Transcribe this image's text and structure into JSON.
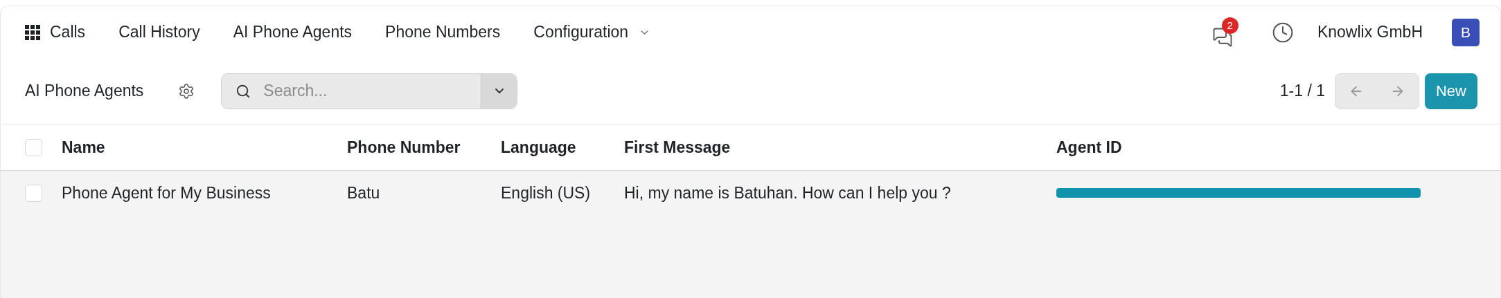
{
  "nav": {
    "items": [
      {
        "label": "Calls",
        "kind": "app"
      },
      {
        "label": "Call History",
        "kind": "link"
      },
      {
        "label": "AI Phone Agents",
        "kind": "link"
      },
      {
        "label": "Phone Numbers",
        "kind": "link"
      },
      {
        "label": "Configuration",
        "kind": "menu"
      }
    ],
    "messages_badge": "2",
    "company": "Knowlix GmbH",
    "avatar": "B"
  },
  "control_panel": {
    "title": "AI Phone Agents",
    "search": {
      "placeholder": "Search..."
    },
    "pager": "1-1 / 1",
    "new_button": "New"
  },
  "table": {
    "columns": [
      "Name",
      "Phone Number",
      "Language",
      "First Message",
      "Agent ID"
    ],
    "header_checked": false,
    "rows": [
      {
        "checked": false,
        "cells": [
          "Phone Agent for My Business",
          "Batu",
          "English (US)",
          "Hi, my name is Batuhan. How can I help you ?"
        ],
        "agent_id_redacted": true
      }
    ]
  }
}
